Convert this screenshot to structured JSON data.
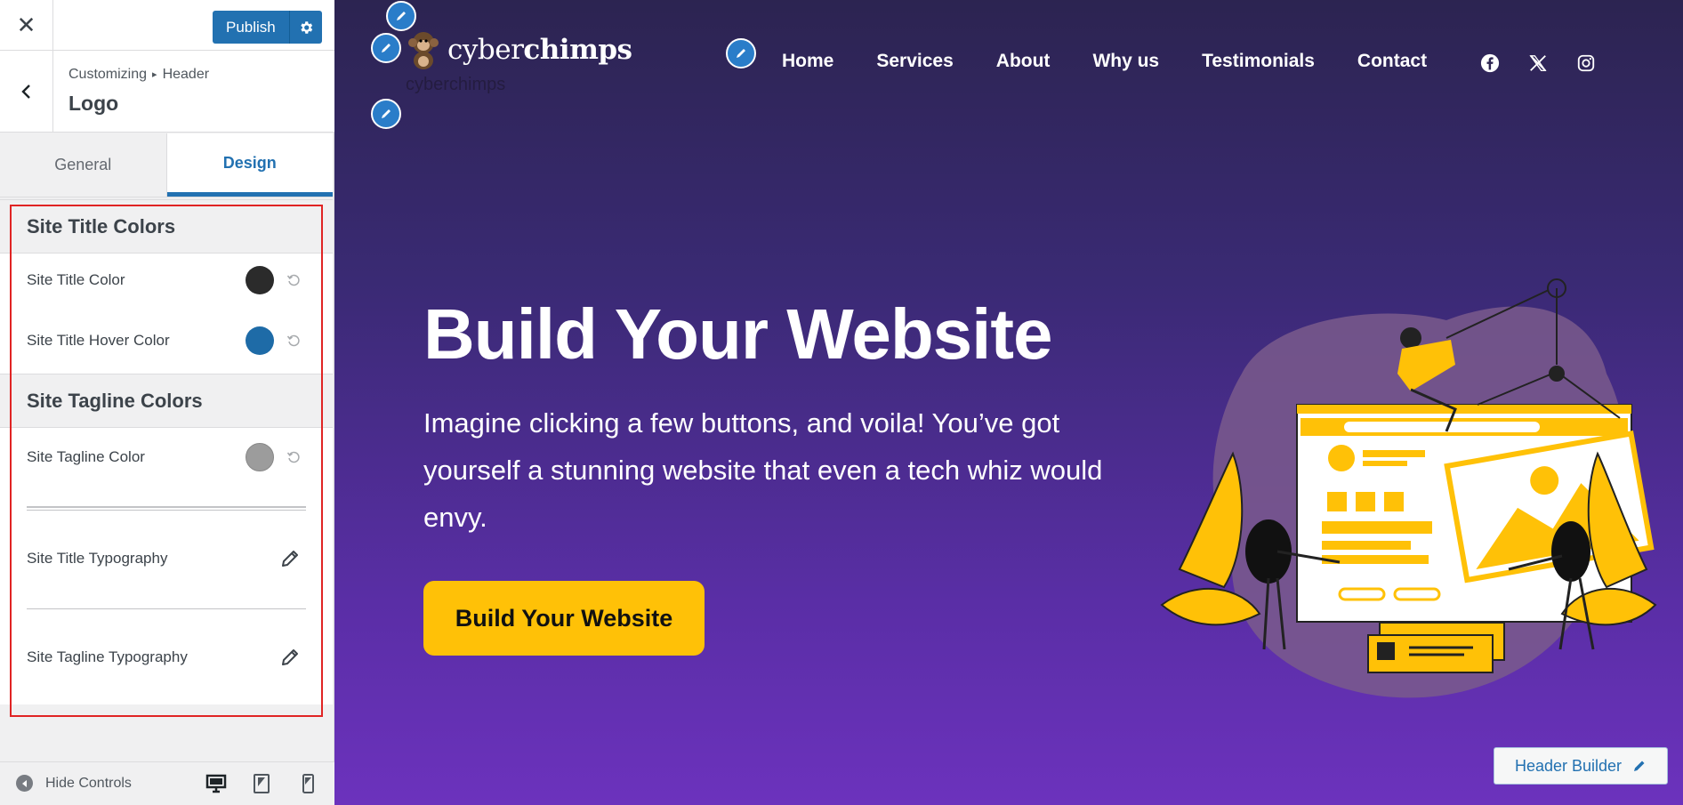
{
  "sidebar": {
    "publish_label": "Publish",
    "breadcrumb": {
      "root": "Customizing",
      "section": "Header"
    },
    "section_title": "Logo",
    "tabs": [
      {
        "label": "General"
      },
      {
        "label": "Design"
      }
    ],
    "active_tab": "Design",
    "groups": {
      "title_colors": {
        "heading": "Site Title Colors",
        "items": [
          {
            "label": "Site Title Color",
            "color": "#2b2b2b"
          },
          {
            "label": "Site Title Hover Color",
            "color": "#1e6ba7"
          }
        ]
      },
      "tagline_colors": {
        "heading": "Site Tagline Colors",
        "items": [
          {
            "label": "Site Tagline Color",
            "color": "#9c9c9c"
          }
        ]
      }
    },
    "typography": [
      {
        "label": "Site Title Typography"
      },
      {
        "label": "Site Tagline Typography"
      }
    ],
    "footer": {
      "hide_controls": "Hide Controls"
    }
  },
  "preview": {
    "logo": {
      "part1": "cyber",
      "part2": "chimps",
      "tagline": "cyberchimps"
    },
    "nav": [
      {
        "label": "Home"
      },
      {
        "label": "Services"
      },
      {
        "label": "About"
      },
      {
        "label": "Why us"
      },
      {
        "label": "Testimonials"
      },
      {
        "label": "Contact"
      }
    ],
    "social_icons": [
      "facebook-icon",
      "x-icon",
      "instagram-icon"
    ],
    "hero": {
      "title": "Build Your Website",
      "subtitle": "Imagine clicking a few buttons, and voila! You’ve got yourself a stunning website that even a tech whiz would envy.",
      "cta": "Build Your Website"
    },
    "header_builder_label": "Header Builder",
    "colors": {
      "accent": "#ffc107",
      "brand_blue": "#2271b1"
    }
  }
}
